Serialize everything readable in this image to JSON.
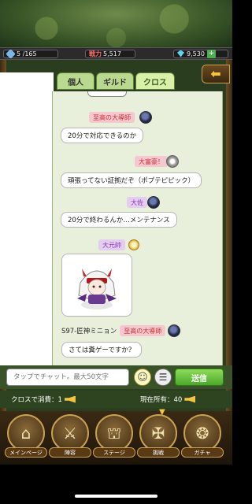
{
  "status": {
    "stamina": "5 /165",
    "power_label": "戦力",
    "power_value": "5,517",
    "gems": "9,530",
    "plus_label": "+"
  },
  "tabs": [
    {
      "label": ""
    },
    {
      "label": "個人"
    },
    {
      "label": "ギルド"
    },
    {
      "label": "クロス"
    }
  ],
  "back_label": "⬅",
  "chat": {
    "messages": [
      {
        "name": "至高の大導師",
        "text": "20分で対応できるのか"
      },
      {
        "name": "大富豪！",
        "text": "頑張ってない証拠だぞ（ポプテピピック）"
      },
      {
        "name": "大佐",
        "text": "20分で終わるんか…メンテナンス"
      },
      {
        "name": "大元帥",
        "text": ""
      }
    ],
    "last_sender_prefix": "S97-匠神ミニョン",
    "last_sender_title": "至高の大導師",
    "last_text": "さては糞ゲーですか？"
  },
  "input": {
    "placeholder": "タップでチャット。最大50文字",
    "emoji": "☺",
    "menu": "☰",
    "send_label": "送信"
  },
  "cost": {
    "left_label": "クロスで消費：1",
    "right_label": "現在所有：40"
  },
  "nav": [
    {
      "label": "メインページ",
      "glyph": "⌂"
    },
    {
      "label": "陣容",
      "glyph": "⚔"
    },
    {
      "label": "ステージ",
      "glyph": "⛫"
    },
    {
      "label": "挑戦",
      "glyph": "✠"
    },
    {
      "label": "ガチャ",
      "glyph": "❂"
    }
  ]
}
